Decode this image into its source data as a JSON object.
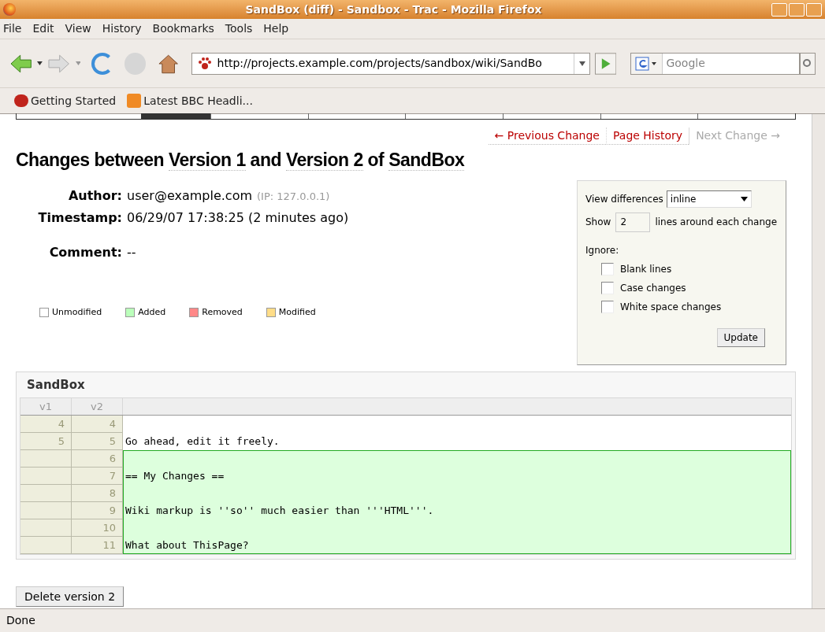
{
  "window": {
    "title": "SandBox (diff) - Sandbox - Trac - Mozilla Firefox"
  },
  "menu": [
    "File",
    "Edit",
    "View",
    "History",
    "Bookmarks",
    "Tools",
    "Help"
  ],
  "address": {
    "value": "http://projects.example.com/projects/sandbox/wiki/SandBo"
  },
  "search": {
    "placeholder": "Google"
  },
  "bookmarks": [
    "Getting Started",
    "Latest BBC Headli..."
  ],
  "nav_links": [
    {
      "label": "← Previous Change",
      "disabled": false
    },
    {
      "label": "Page History",
      "disabled": false
    },
    {
      "label": "Next Change →",
      "disabled": true
    }
  ],
  "heading": {
    "parts": [
      "Changes between ",
      "Version 1",
      " and ",
      "Version 2",
      " of ",
      "SandBox"
    ]
  },
  "info": [
    {
      "label": "Author:",
      "value": "user@example.com",
      "note": "(IP: 127.0.0.1)"
    },
    {
      "label": "Timestamp:",
      "value": "06/29/07 17:38:25 (2 minutes ago)"
    }
  ],
  "comment": {
    "label": "Comment:",
    "text": "--"
  },
  "legend": [
    {
      "label": "Unmodified",
      "color": "#ffffff"
    },
    {
      "label": "Added",
      "color": "#bbffbb"
    },
    {
      "label": "Removed",
      "color": "#ff8888"
    },
    {
      "label": "Modified",
      "color": "#ffdd88"
    }
  ],
  "options": {
    "view_label": "View differences",
    "view_value": "inline",
    "show_label": "Show",
    "show_value": "2",
    "show_suffix": "lines around each change",
    "ignore_label": "Ignore:",
    "ignore": [
      {
        "label": "Blank lines",
        "checked": false
      },
      {
        "label": "Case changes",
        "checked": false
      },
      {
        "label": "White space changes",
        "checked": false
      }
    ],
    "button": "Update"
  },
  "diff": {
    "title": "SandBox",
    "columns": [
      "v1",
      "v2"
    ],
    "rows": [
      {
        "kind": "unmodified",
        "v1": "4",
        "v2": "4",
        "text": ""
      },
      {
        "kind": "unmodified",
        "v1": "5",
        "v2": "5",
        "text": "Go ahead, edit it freely."
      },
      {
        "kind": "added",
        "v2": "6",
        "text": ""
      },
      {
        "kind": "added",
        "v2": "7",
        "text": "== My Changes =="
      },
      {
        "kind": "added",
        "v2": "8",
        "text": ""
      },
      {
        "kind": "added",
        "v2": "9",
        "text": "Wiki markup is ''so'' much easier than '''HTML'''."
      },
      {
        "kind": "added",
        "v2": "10",
        "text": ""
      },
      {
        "kind": "added",
        "v2": "11",
        "text": "What about ThisPage?"
      }
    ]
  },
  "delete_button": "Delete version 2",
  "status_bar": "Done"
}
